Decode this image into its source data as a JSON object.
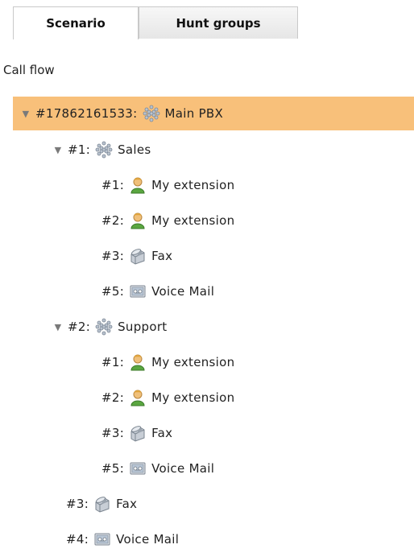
{
  "tabs": [
    {
      "label": "Scenario",
      "active": true
    },
    {
      "label": "Hunt groups",
      "active": false
    }
  ],
  "section_label": "Call flow",
  "tree": {
    "root": {
      "number": "#17862161533:",
      "icon": "group-icon",
      "label": "Main PBX"
    },
    "groups": [
      {
        "number": "#1:",
        "icon": "group-icon",
        "label": "Sales",
        "children": [
          {
            "number": "#1:",
            "icon": "user-icon",
            "label": "My extension"
          },
          {
            "number": "#2:",
            "icon": "user-icon",
            "label": "My extension"
          },
          {
            "number": "#3:",
            "icon": "fax-icon",
            "label": "Fax"
          },
          {
            "number": "#5:",
            "icon": "voicemail-icon",
            "label": "Voice Mail"
          }
        ]
      },
      {
        "number": "#2:",
        "icon": "group-icon",
        "label": "Support",
        "children": [
          {
            "number": "#1:",
            "icon": "user-icon",
            "label": "My extension"
          },
          {
            "number": "#2:",
            "icon": "user-icon",
            "label": "My extension"
          },
          {
            "number": "#3:",
            "icon": "fax-icon",
            "label": "Fax"
          },
          {
            "number": "#5:",
            "icon": "voicemail-icon",
            "label": "Voice Mail"
          }
        ]
      }
    ],
    "root_items": [
      {
        "number": "#3:",
        "icon": "fax-icon",
        "label": "Fax"
      },
      {
        "number": "#4:",
        "icon": "voicemail-icon",
        "label": "Voice Mail"
      }
    ]
  },
  "colors": {
    "root_highlight": "#f8c07a",
    "toggle": "#7a7a7a"
  }
}
